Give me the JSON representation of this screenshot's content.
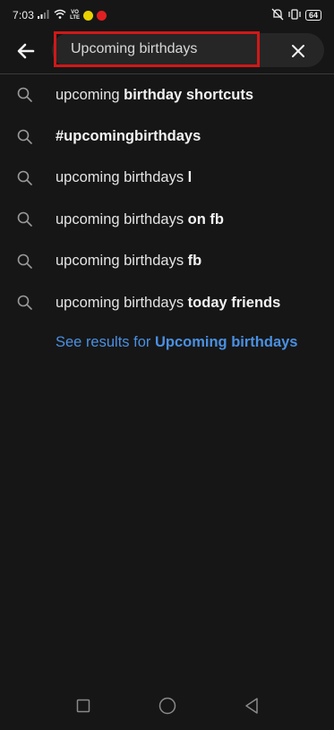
{
  "status_bar": {
    "time": "7:03",
    "network_label_top": "VO",
    "network_label_bottom": "LTE",
    "battery": "64"
  },
  "search": {
    "value": "Upcoming birthdays"
  },
  "suggestions": [
    {
      "plain": "upcoming ",
      "bold": "birthday shortcuts"
    },
    {
      "plain": "",
      "bold": "#upcomingbirthdays"
    },
    {
      "plain": "upcoming birthdays ",
      "bold": "l"
    },
    {
      "plain": "upcoming birthdays ",
      "bold": "on fb"
    },
    {
      "plain": "upcoming birthdays ",
      "bold": "fb"
    },
    {
      "plain": "upcoming birthdays ",
      "bold": "today friends"
    }
  ],
  "see_results": {
    "prefix": "See results for ",
    "query": "Upcoming birthdays"
  },
  "colors": {
    "background": "#161616",
    "highlight_border": "#d01818",
    "link": "#4a90e2"
  },
  "icons": {
    "back": "arrow-left-icon",
    "clear": "close-icon",
    "suggestion": "search-icon",
    "nav_recents": "square-icon",
    "nav_home": "circle-icon",
    "nav_back": "triangle-back-icon"
  }
}
